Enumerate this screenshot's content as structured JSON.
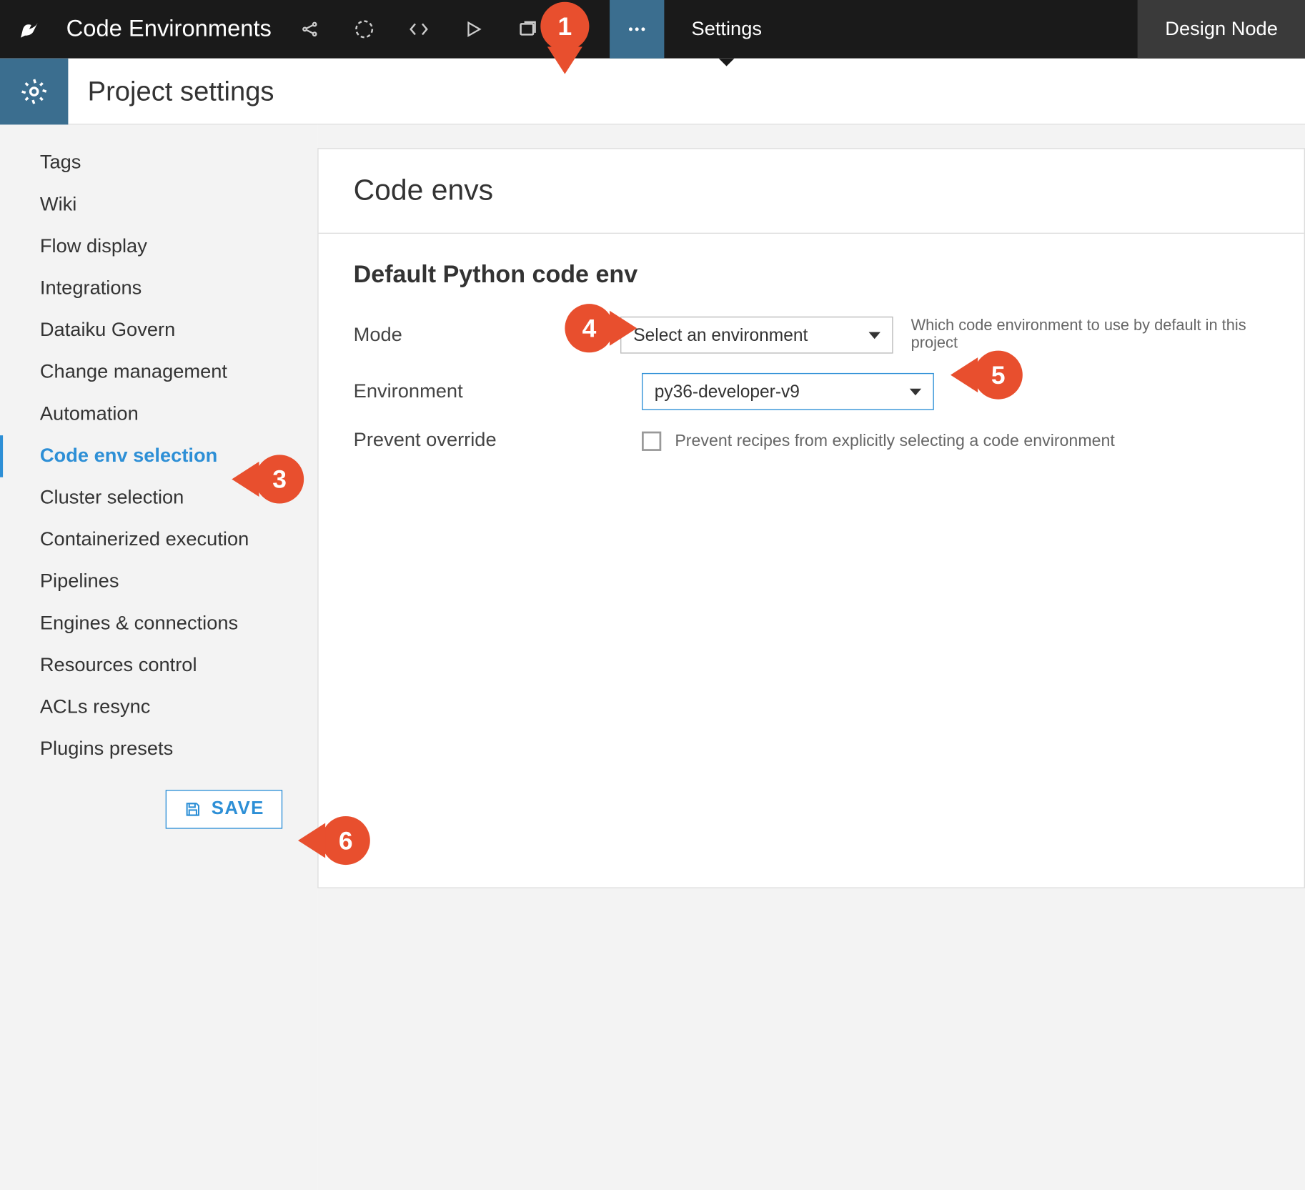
{
  "topbar": {
    "title": "Code Environments",
    "settings_tab": "Settings",
    "right_label": "Design Node"
  },
  "subheader": {
    "title": "Project settings"
  },
  "sidebar": {
    "items": [
      {
        "label": "Tags"
      },
      {
        "label": "Wiki"
      },
      {
        "label": "Flow display"
      },
      {
        "label": "Integrations"
      },
      {
        "label": "Dataiku Govern"
      },
      {
        "label": "Change management"
      },
      {
        "label": "Automation"
      },
      {
        "label": "Code env selection"
      },
      {
        "label": "Cluster selection"
      },
      {
        "label": "Containerized execution"
      },
      {
        "label": "Pipelines"
      },
      {
        "label": "Engines & connections"
      },
      {
        "label": "Resources control"
      },
      {
        "label": "ACLs resync"
      },
      {
        "label": "Plugins presets"
      }
    ],
    "active_index": 7,
    "save_label": "SAVE"
  },
  "panel": {
    "title": "Code envs",
    "section": "Default Python code env",
    "mode_label": "Mode",
    "mode_value": "Select an environment",
    "mode_hint": "Which code environment to use by default in this project",
    "env_label": "Environment",
    "env_value": "py36-developer-v9",
    "prevent_label": "Prevent override",
    "prevent_hint": "Prevent recipes from explicitly selecting a code environment"
  },
  "callouts": {
    "c1": "1",
    "c3": "3",
    "c4": "4",
    "c5": "5",
    "c6": "6"
  }
}
